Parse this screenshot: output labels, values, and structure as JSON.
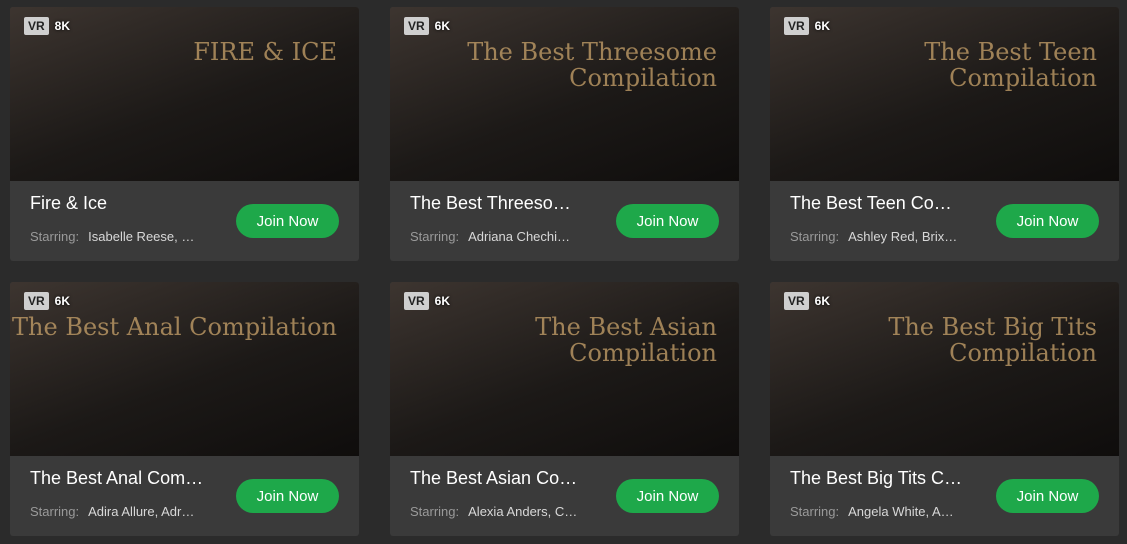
{
  "ui": {
    "starring_label": "Starring:",
    "join_label": "Join Now",
    "vr_badge": "VR"
  },
  "cards": [
    {
      "resolution": "8K",
      "title": "Fire & Ice",
      "thumb_text": "FIRE & ICE",
      "starring": "Isabelle Reese, …"
    },
    {
      "resolution": "6K",
      "title": "The Best Threeso…",
      "thumb_text": "The Best Threesome Compilation",
      "starring": "Adriana Chechi…"
    },
    {
      "resolution": "6K",
      "title": "The Best Teen Co…",
      "thumb_text": "The Best Teen Compilation",
      "starring": "Ashley Red, Brix…"
    },
    {
      "resolution": "6K",
      "title": "The Best Anal Com…",
      "thumb_text": "The Best Anal Compilation",
      "starring": "Adira Allure, Adr…"
    },
    {
      "resolution": "6K",
      "title": "The Best Asian Co…",
      "thumb_text": "The Best Asian Compilation",
      "starring": "Alexia Anders, C…"
    },
    {
      "resolution": "6K",
      "title": "The Best Big Tits C…",
      "thumb_text": "The Best Big Tits Compilation",
      "starring": "Angela White, A…"
    }
  ]
}
